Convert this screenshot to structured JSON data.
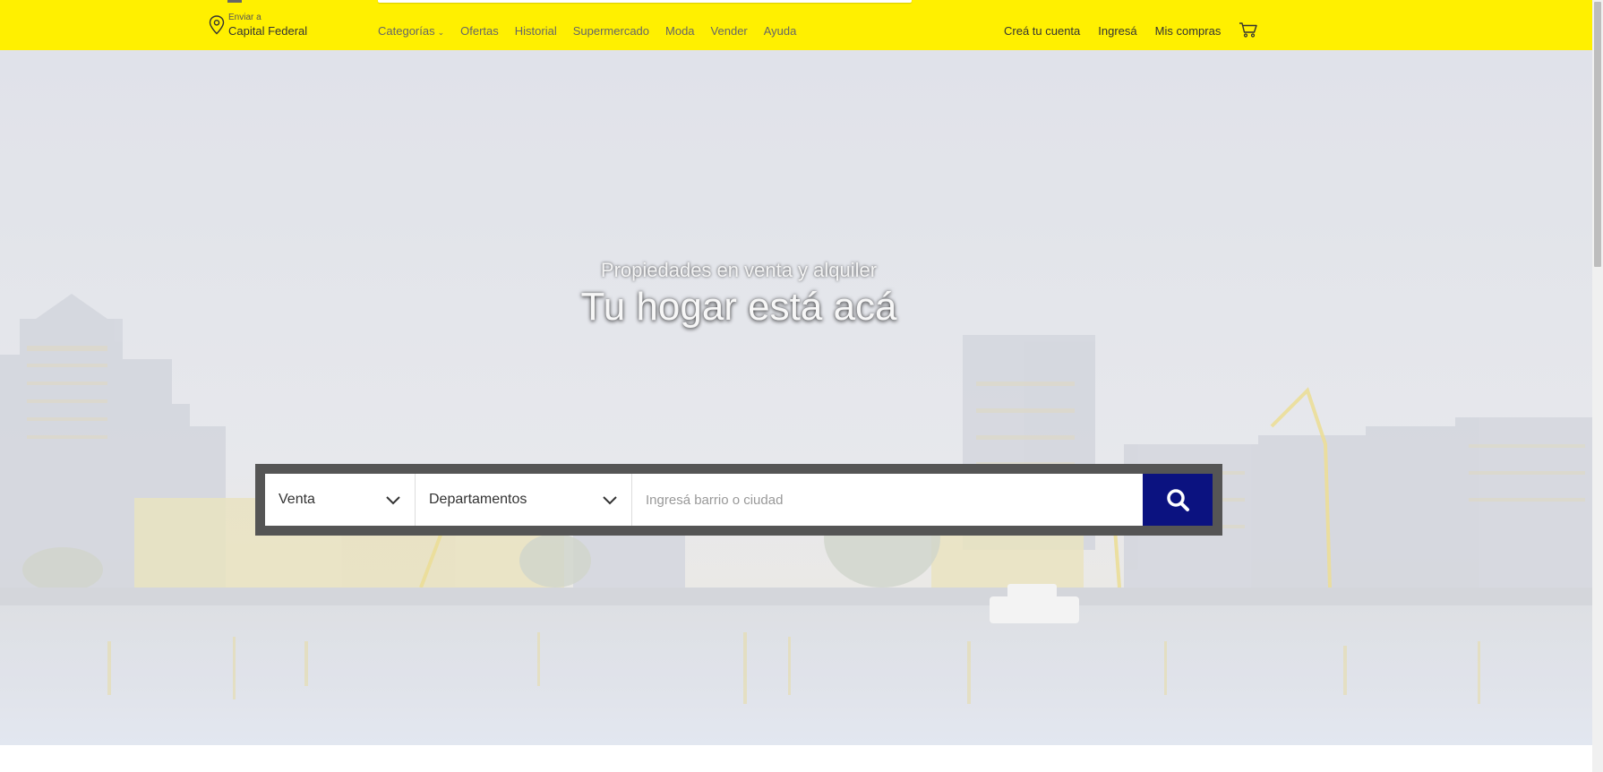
{
  "header": {
    "location": {
      "small": "Enviar a",
      "city": "Capital Federal"
    },
    "nav": [
      {
        "label": "Categorías",
        "dropdown": true
      },
      {
        "label": "Ofertas"
      },
      {
        "label": "Historial"
      },
      {
        "label": "Supermercado"
      },
      {
        "label": "Moda"
      },
      {
        "label": "Vender"
      },
      {
        "label": "Ayuda"
      }
    ],
    "account": {
      "create": "Creá tu cuenta",
      "login": "Ingresá",
      "purchases": "Mis compras"
    }
  },
  "hero": {
    "subtitle": "Propiedades en venta y alquiler",
    "title": "Tu hogar está acá"
  },
  "search": {
    "operation": "Venta",
    "property_type": "Departamentos",
    "placeholder": "Ingresá barrio o ciudad"
  },
  "colors": {
    "brand_yellow": "#fff000",
    "search_button": "#0b1280"
  },
  "icons": {
    "location": "location-pin-icon",
    "cart": "cart-icon",
    "search": "search-icon",
    "chevron": "chevron-down-icon"
  }
}
